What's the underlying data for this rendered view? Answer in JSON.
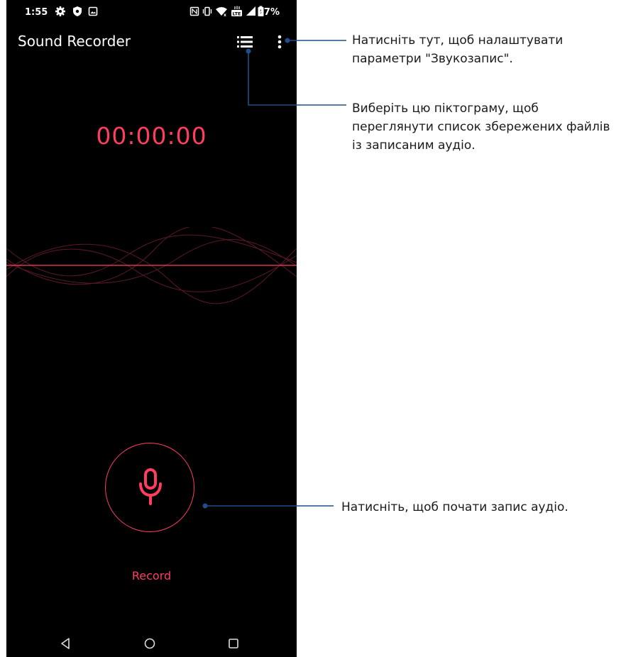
{
  "status_bar": {
    "time": "1:55",
    "battery_percent": "97%",
    "icons": [
      "gear-icon",
      "shield-icon",
      "image-icon",
      "nfc-icon",
      "vibrate-icon",
      "wifi-icon",
      "lte-icon",
      "cell-signal-icon",
      "battery-icon"
    ]
  },
  "app": {
    "title": "Sound Recorder",
    "timer": "00:00:00",
    "record_label": "Record"
  },
  "navigation": [
    "back-icon",
    "home-icon",
    "recents-icon"
  ],
  "callouts": {
    "menu": "Натисніть тут, щоб налаштувати\nпараметри \"Звукозапис\".",
    "list": "Виберіть цю піктограму, щоб\nпереглянути список збережених файлів\nіз записаним аудіо.",
    "record": "Натисніть, щоб почати запис аудіо."
  },
  "colors": {
    "accent": "#ff3d5e",
    "background": "#000000",
    "callout_line": "#1f4e8c"
  }
}
